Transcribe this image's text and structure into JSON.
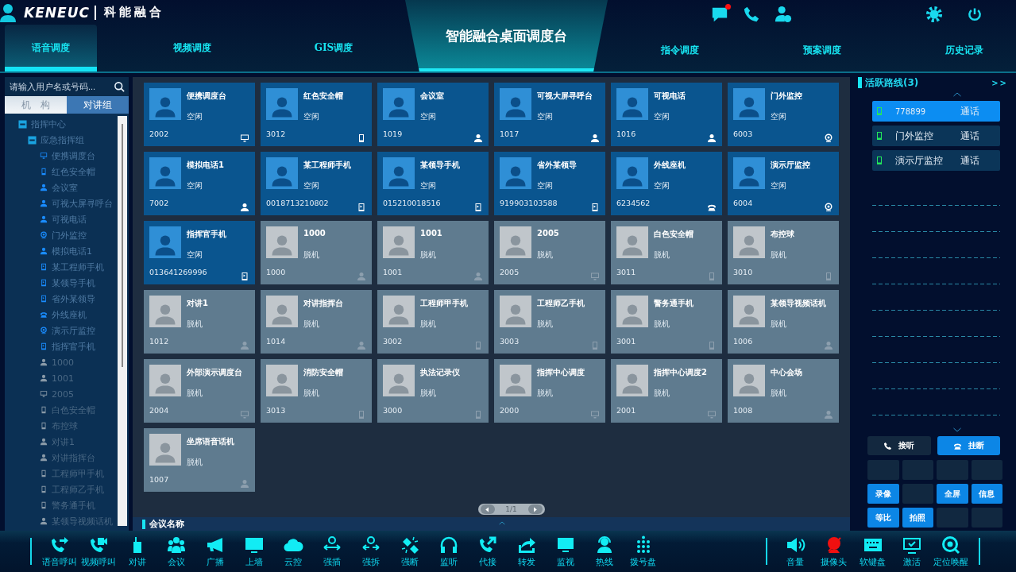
{
  "header": {
    "logo": {
      "brand": "KENEUC",
      "name": "科能融合"
    },
    "title": "智能融合桌面调度台",
    "tabs_left": [
      {
        "label": "语音调度",
        "selected": true
      },
      {
        "label": "视频调度",
        "selected": false
      },
      {
        "label": "GIS调度",
        "selected": false
      }
    ],
    "tabs_right": [
      {
        "label": "指令调度",
        "selected": false
      },
      {
        "label": "预案调度",
        "selected": false
      },
      {
        "label": "历史记录",
        "selected": false
      }
    ],
    "icons": [
      {
        "kind": "chat",
        "badge": true
      },
      {
        "kind": "call",
        "badge": false
      },
      {
        "kind": "user-clock",
        "badge": false
      },
      {
        "kind": "gear",
        "badge": false
      },
      {
        "kind": "power",
        "badge": false
      }
    ]
  },
  "sidebar": {
    "search": {
      "placeholder": "请输入用户名或号码..."
    },
    "tabs": [
      {
        "label": "机　构",
        "selected": true
      },
      {
        "label": "对讲组",
        "selected": false
      }
    ],
    "tree": [
      {
        "label": "指挥中心",
        "expanded": true,
        "children": [
          {
            "label": "应急指挥组",
            "expanded": true,
            "children": [
              {
                "label": "便携调度台",
                "kind": "monitor",
                "online": true
              },
              {
                "label": "红色安全帽",
                "kind": "phone",
                "online": true
              },
              {
                "label": "会议室",
                "kind": "person",
                "online": true
              },
              {
                "label": "可视大屏寻呼台",
                "kind": "person",
                "online": true
              },
              {
                "label": "可视电话",
                "kind": "person",
                "online": true
              },
              {
                "label": "门外监控",
                "kind": "camera",
                "online": true
              },
              {
                "label": "模拟电话1",
                "kind": "person",
                "online": true
              },
              {
                "label": "某工程师手机",
                "kind": "mobile",
                "online": true
              },
              {
                "label": "某领导手机",
                "kind": "mobile",
                "online": true
              },
              {
                "label": "省外某领导",
                "kind": "mobile",
                "online": true
              },
              {
                "label": "外线座机",
                "kind": "telephone",
                "online": true
              },
              {
                "label": "演示厅监控",
                "kind": "camera",
                "online": true
              },
              {
                "label": "指挥官手机",
                "kind": "mobile",
                "online": true
              },
              {
                "label": "1000",
                "kind": "person",
                "online": false
              },
              {
                "label": "1001",
                "kind": "person",
                "online": false
              },
              {
                "label": "2005",
                "kind": "monitor",
                "online": false
              },
              {
                "label": "白色安全帽",
                "kind": "phone",
                "online": false
              },
              {
                "label": "布控球",
                "kind": "phone",
                "online": false
              },
              {
                "label": "对讲1",
                "kind": "person",
                "online": false
              },
              {
                "label": "对讲指挥台",
                "kind": "person",
                "online": false
              },
              {
                "label": "工程师甲手机",
                "kind": "phone",
                "online": false
              },
              {
                "label": "工程师乙手机",
                "kind": "phone",
                "online": false
              },
              {
                "label": "警务通手机",
                "kind": "phone",
                "online": false
              },
              {
                "label": "某领导视频话机",
                "kind": "person",
                "online": false
              }
            ]
          }
        ]
      }
    ]
  },
  "main": {
    "cards": [
      {
        "name": "便携调度台",
        "status": "空闲",
        "number": "2002",
        "kind": "monitor",
        "online": true
      },
      {
        "name": "红色安全帽",
        "status": "空闲",
        "number": "3012",
        "kind": "phone",
        "online": true
      },
      {
        "name": "会议室",
        "status": "空闲",
        "number": "1019",
        "kind": "person",
        "online": true
      },
      {
        "name": "可视大屏寻呼台",
        "status": "空闲",
        "number": "1017",
        "kind": "person",
        "online": true
      },
      {
        "name": "可视电话",
        "status": "空闲",
        "number": "1016",
        "kind": "person",
        "online": true
      },
      {
        "name": "门外监控",
        "status": "空闲",
        "number": "6003",
        "kind": "camera",
        "online": true
      },
      {
        "name": "模拟电话1",
        "status": "空闲",
        "number": "7002",
        "kind": "person",
        "online": true
      },
      {
        "name": "某工程师手机",
        "status": "空闲",
        "number": "0018713210802",
        "kind": "mobile",
        "online": true
      },
      {
        "name": "某领导手机",
        "status": "空闲",
        "number": "015210018516",
        "kind": "mobile",
        "online": true
      },
      {
        "name": "省外某领导",
        "status": "空闲",
        "number": "919903103588",
        "kind": "mobile",
        "online": true
      },
      {
        "name": "外线座机",
        "status": "空闲",
        "number": "6234562",
        "kind": "telephone",
        "online": true
      },
      {
        "name": "演示厅监控",
        "status": "空闲",
        "number": "6004",
        "kind": "camera",
        "online": true
      },
      {
        "name": "指挥官手机",
        "status": "空闲",
        "number": "013641269996",
        "kind": "mobile",
        "online": true
      },
      {
        "name": "1000",
        "status": "脱机",
        "number": "1000",
        "kind": "person",
        "online": false
      },
      {
        "name": "1001",
        "status": "脱机",
        "number": "1001",
        "kind": "person",
        "online": false
      },
      {
        "name": "2005",
        "status": "脱机",
        "number": "2005",
        "kind": "monitor",
        "online": false
      },
      {
        "name": "白色安全帽",
        "status": "脱机",
        "number": "3011",
        "kind": "phone",
        "online": false
      },
      {
        "name": "布控球",
        "status": "脱机",
        "number": "3010",
        "kind": "phone",
        "online": false
      },
      {
        "name": "对讲1",
        "status": "脱机",
        "number": "1012",
        "kind": "person",
        "online": false
      },
      {
        "name": "对讲指挥台",
        "status": "脱机",
        "number": "1014",
        "kind": "person",
        "online": false
      },
      {
        "name": "工程师甲手机",
        "status": "脱机",
        "number": "3002",
        "kind": "phone",
        "online": false
      },
      {
        "name": "工程师乙手机",
        "status": "脱机",
        "number": "3003",
        "kind": "phone",
        "online": false
      },
      {
        "name": "警务通手机",
        "status": "脱机",
        "number": "3001",
        "kind": "phone",
        "online": false
      },
      {
        "name": "某领导视频话机",
        "status": "脱机",
        "number": "1006",
        "kind": "person",
        "online": false
      },
      {
        "name": "外部演示调度台",
        "status": "脱机",
        "number": "2004",
        "kind": "monitor",
        "online": false
      },
      {
        "name": "消防安全帽",
        "status": "脱机",
        "number": "3013",
        "kind": "phone",
        "online": false
      },
      {
        "name": "执法记录仪",
        "status": "脱机",
        "number": "3000",
        "kind": "phone",
        "online": false
      },
      {
        "name": "指挥中心调度",
        "status": "脱机",
        "number": "2000",
        "kind": "monitor",
        "online": false
      },
      {
        "name": "指挥中心调度2",
        "status": "脱机",
        "number": "2001",
        "kind": "monitor",
        "online": false
      },
      {
        "name": "中心会场",
        "status": "脱机",
        "number": "1008",
        "kind": "person",
        "online": false
      },
      {
        "name": "坐席语音话机",
        "status": "脱机",
        "number": "1007",
        "kind": "person",
        "online": false
      }
    ],
    "pager": {
      "page": "1/1"
    },
    "meeting_bar": {
      "title": "会议名称"
    }
  },
  "active_lines": {
    "title": "活跃路线(3)",
    "expand": ">>",
    "lines": [
      {
        "name": "778899",
        "state": "通话",
        "selected": true
      },
      {
        "name": "门外监控",
        "state": "通话",
        "selected": false
      },
      {
        "name": "演示厅监控",
        "state": "通话",
        "selected": false
      }
    ],
    "answer": "接听",
    "hangup": "挂断",
    "keys": [
      {
        "kind": "blank"
      },
      {
        "kind": "blank"
      },
      {
        "kind": "blank"
      },
      {
        "kind": "blank"
      },
      {
        "kind": "action",
        "label": "录像"
      },
      {
        "kind": "blank"
      },
      {
        "kind": "action",
        "label": "全屏"
      },
      {
        "kind": "action",
        "label": "信息"
      },
      {
        "kind": "action",
        "label": "等比"
      },
      {
        "kind": "action",
        "label": "拍照"
      },
      {
        "kind": "blank"
      },
      {
        "kind": "blank"
      }
    ]
  },
  "toolbar": {
    "left": [
      {
        "label": "语音呼叫",
        "kind": "call-out"
      },
      {
        "label": "视频呼叫",
        "kind": "video-call"
      },
      {
        "label": "对讲",
        "kind": "walkie"
      },
      {
        "label": "会议",
        "kind": "group"
      },
      {
        "label": "广播",
        "kind": "megaphone"
      },
      {
        "label": "上墙",
        "kind": "screen-up"
      },
      {
        "label": "云控",
        "kind": "cloud"
      },
      {
        "label": "强插",
        "kind": "insert"
      },
      {
        "label": "强拆",
        "kind": "split"
      },
      {
        "label": "强断",
        "kind": "break"
      },
      {
        "label": "监听",
        "kind": "headset"
      },
      {
        "label": "代接",
        "kind": "call-pickup"
      },
      {
        "label": "转发",
        "kind": "share"
      },
      {
        "label": "监视",
        "kind": "monitor-eye"
      },
      {
        "label": "热线",
        "kind": "agent"
      },
      {
        "label": "拨号盘",
        "kind": "dialpad"
      }
    ],
    "right": [
      {
        "label": "音量",
        "kind": "speaker",
        "disabled": false
      },
      {
        "label": "摄像头",
        "kind": "webcam",
        "disabled": true
      },
      {
        "label": "软键盘",
        "kind": "keyboard",
        "disabled": false
      },
      {
        "label": "激活",
        "kind": "screen-check",
        "disabled": false
      },
      {
        "label": "定位唤醒",
        "kind": "locate",
        "disabled": false
      }
    ]
  }
}
